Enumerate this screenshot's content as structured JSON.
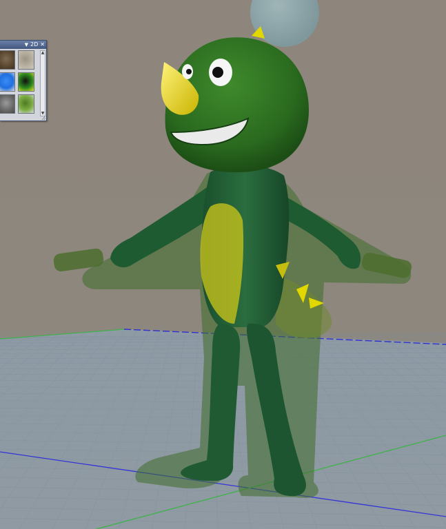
{
  "panel": {
    "title_label": "2D",
    "close_label": "✕",
    "menu_icon": "dropdown-arrow-icon",
    "thumbnails": [
      {
        "name": "thumb-forest",
        "colors": [
          "#5e4a33",
          "#7d6b52",
          "#3f3121"
        ]
      },
      {
        "name": "thumb-gravel",
        "colors": [
          "#b8b0a0",
          "#9c9384",
          "#d0c8b8"
        ]
      },
      {
        "name": "thumb-blue-shape",
        "colors": [
          "#1f6fe0",
          "#3b8cf5",
          "#d9dde4"
        ]
      },
      {
        "name": "thumb-spotted",
        "colors": [
          "#2d8a1f",
          "#111111",
          "#e3e226"
        ]
      },
      {
        "name": "thumb-stone",
        "colors": [
          "#6b6b6b",
          "#9a9a9a",
          "#4a4a4a"
        ]
      },
      {
        "name": "thumb-leaf",
        "colors": [
          "#7fae45",
          "#4d7a24",
          "#d9dde4"
        ]
      }
    ]
  },
  "scene": {
    "background": "#8e867c",
    "floor_grid_color": "#7d8fa3",
    "axis_blue": "#2f2fd0",
    "axis_green": "#3fb24a",
    "character_skin": "#1f5e2d",
    "character_belly": "#c6c21a",
    "horn_color": "#e8d800",
    "sphere_color": "#8aa3a8"
  }
}
